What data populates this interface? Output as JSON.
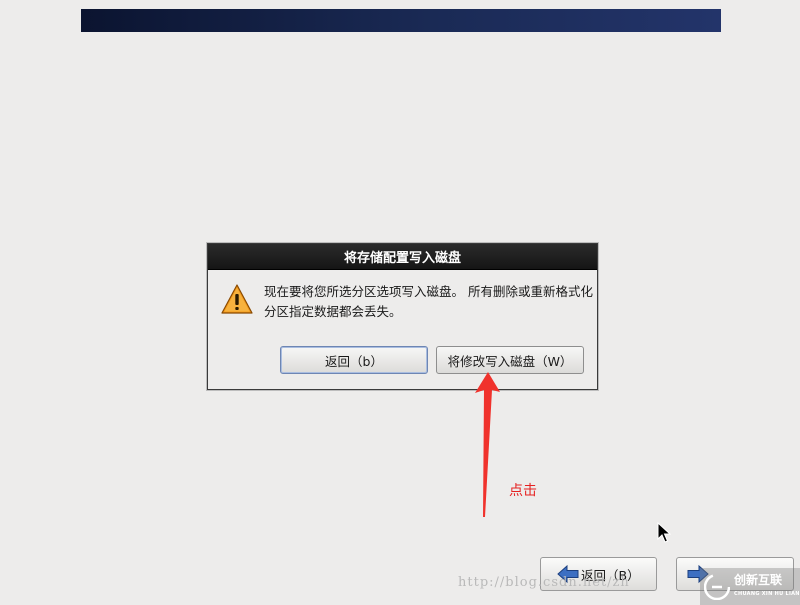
{
  "dialog": {
    "title": "将存储配置写入磁盘",
    "message": "现在要将您所选分区选项写入磁盘。 所有删除或重新格式化分区指定数据都会丢失。",
    "back_button": "返回（b）",
    "write_button": "将修改写入磁盘（W）"
  },
  "annotation": {
    "label": "点击",
    "color": "#e52222"
  },
  "nav": {
    "back_label": "返回（B）"
  },
  "watermark": {
    "text": "http://blog.csdn.net/zh"
  },
  "logo": {
    "text": "创新互联",
    "subtext": "CHUANG XIN HU LIAN"
  },
  "colors": {
    "banner": "#1a2a55",
    "background": "#edeceb",
    "titlebar": "#1e1e1e"
  },
  "icons": {
    "dialog": "warning-icon",
    "nav_back": "arrow-left-icon",
    "nav_next": "arrow-right-icon",
    "pointer": "mouse-cursor-icon"
  }
}
